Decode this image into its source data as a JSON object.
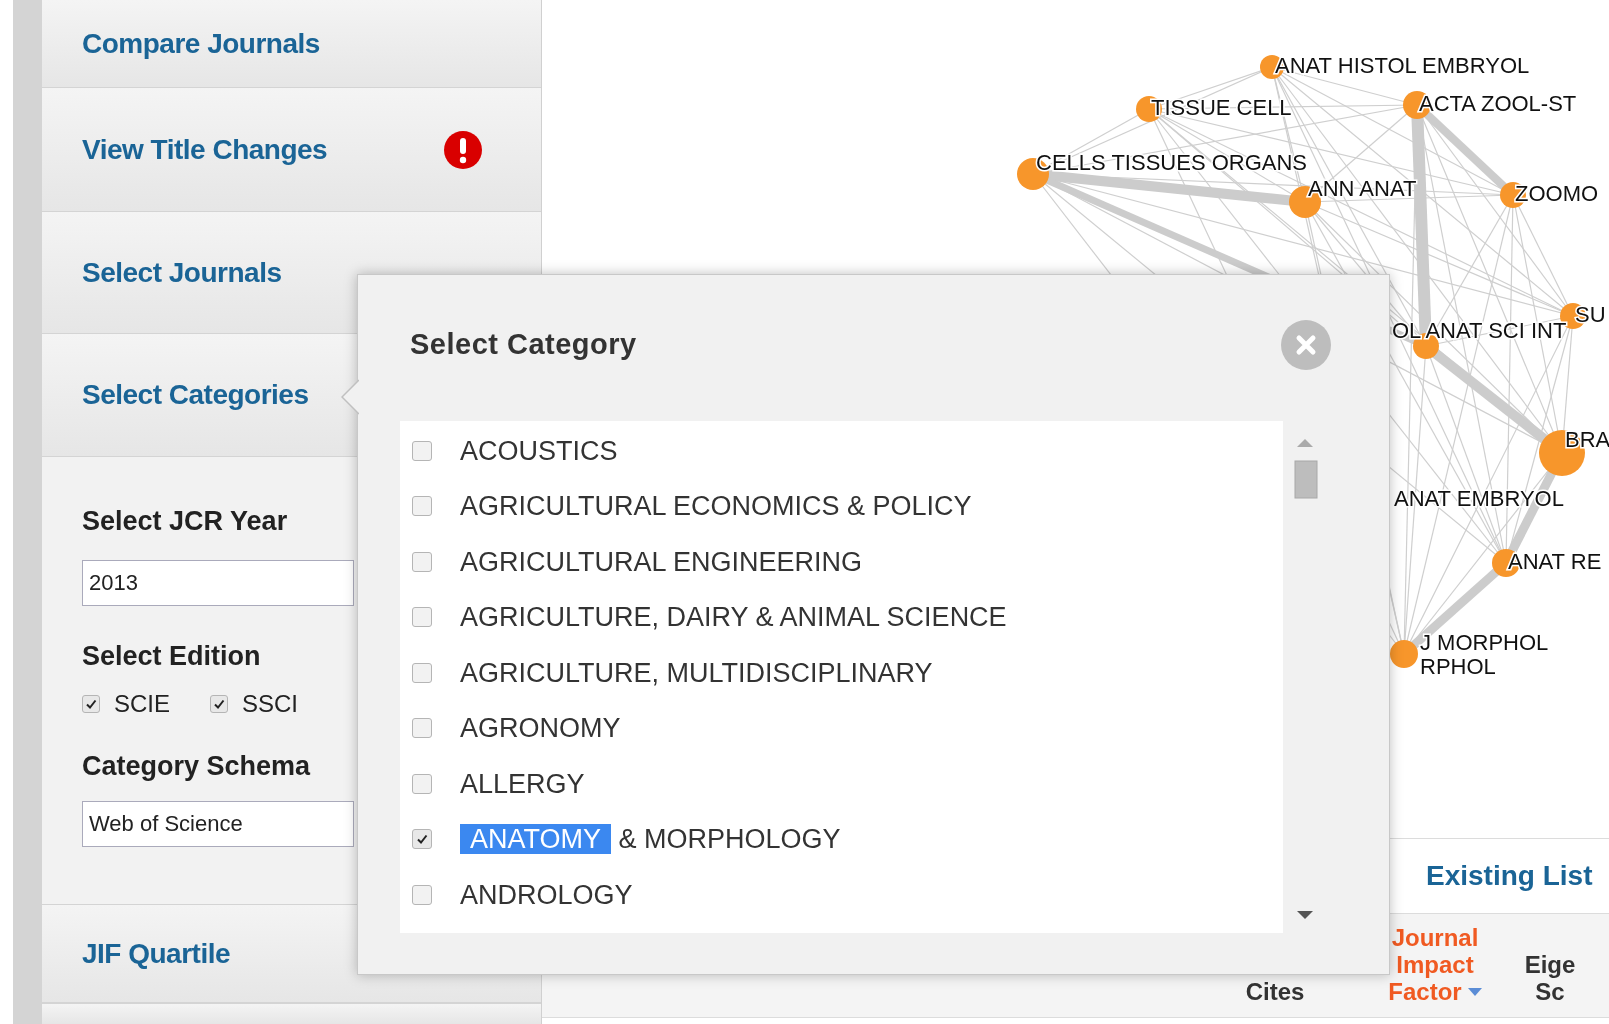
{
  "sidebar": {
    "items": [
      {
        "label": "Compare Journals",
        "alert": false
      },
      {
        "label": "View Title Changes",
        "alert": true
      },
      {
        "label": "Select Journals",
        "alert": false
      },
      {
        "label": "Select Categories"
      }
    ],
    "filters": {
      "year_label": "Select JCR Year",
      "year_value": "2013",
      "edition_label": "Select Edition",
      "editions": [
        {
          "label": "SCIE",
          "checked": true
        },
        {
          "label": "SSCI",
          "checked": true
        }
      ],
      "schema_label": "Category Schema",
      "schema_value": "Web of Science"
    },
    "bottom_items": [
      {
        "label": "JIF Quartile"
      }
    ]
  },
  "graph": {
    "nodes": [
      {
        "label": "ANAT HISTOL EMBRYOL"
      },
      {
        "label": "TISSUE CELL"
      },
      {
        "label": "ACTA ZOOL-ST"
      },
      {
        "label": "CELLS TISSUES ORGANS"
      },
      {
        "label": "ANN ANAT"
      },
      {
        "label": "ZOOMO"
      },
      {
        "label": "SU"
      },
      {
        "label": "OL ANAT SCI INT"
      },
      {
        "label": "BRA"
      },
      {
        "label": "ANAT EMBRYOL"
      },
      {
        "label": "ANAT RE"
      },
      {
        "label": "J MORPHOL"
      },
      {
        "label": "RPHOL"
      }
    ]
  },
  "list_panel": {
    "title": "Existing List"
  },
  "table": {
    "columns": [
      {
        "lines": [
          "Cites"
        ],
        "sorted": false
      },
      {
        "lines": [
          "Journal",
          "Impact",
          "Factor"
        ],
        "sorted": true
      },
      {
        "lines": [
          "Eige",
          "Sc"
        ],
        "sorted": false
      }
    ]
  },
  "modal": {
    "title": "Select Category",
    "categories": [
      {
        "label_parts": [
          {
            "text": "ACOUSTICS",
            "highlighted": false
          }
        ],
        "checked": false
      },
      {
        "label_parts": [
          {
            "text": "AGRICULTURAL ECONOMICS & POLICY",
            "highlighted": false
          }
        ],
        "checked": false
      },
      {
        "label_parts": [
          {
            "text": "AGRICULTURAL ENGINEERING",
            "highlighted": false
          }
        ],
        "checked": false
      },
      {
        "label_parts": [
          {
            "text": "AGRICULTURE, DAIRY & ANIMAL SCIENCE",
            "highlighted": false
          }
        ],
        "checked": false
      },
      {
        "label_parts": [
          {
            "text": "AGRICULTURE, MULTIDISCIPLINARY",
            "highlighted": false
          }
        ],
        "checked": false
      },
      {
        "label_parts": [
          {
            "text": "AGRONOMY",
            "highlighted": false
          }
        ],
        "checked": false
      },
      {
        "label_parts": [
          {
            "text": "ALLERGY",
            "highlighted": false
          }
        ],
        "checked": false
      },
      {
        "label_parts": [
          {
            "text": "ANATOMY",
            "highlighted": true
          },
          {
            "text": "& MORPHOLOGY",
            "highlighted": false
          }
        ],
        "checked": true
      },
      {
        "label_parts": [
          {
            "text": "ANDROLOGY",
            "highlighted": false
          }
        ],
        "checked": false
      }
    ]
  }
}
